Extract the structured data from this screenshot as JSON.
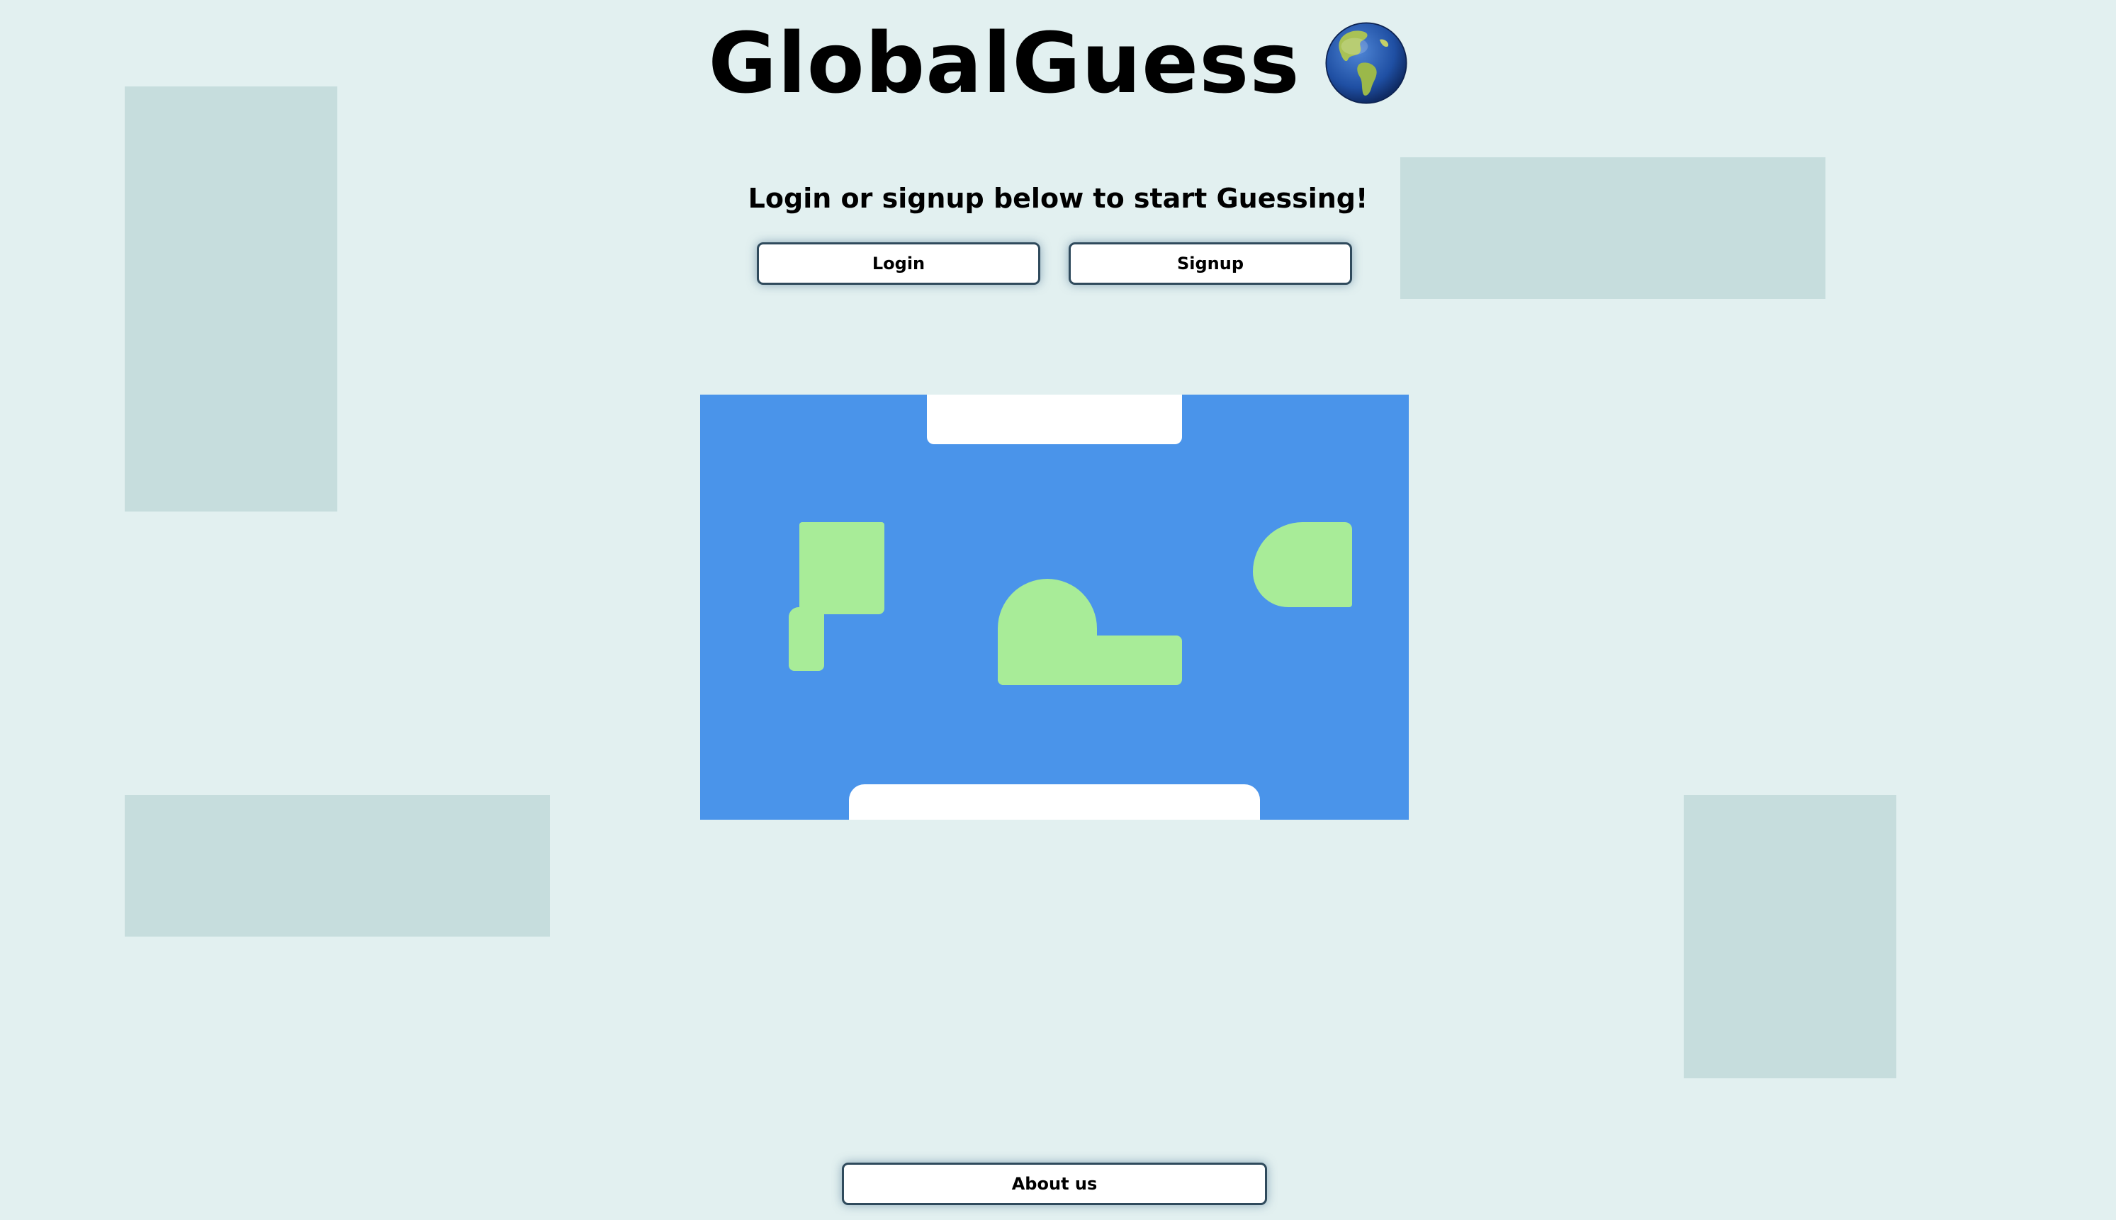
{
  "header": {
    "title": "GlobalGuess",
    "icon": "globe-americas-icon"
  },
  "prompt": {
    "text": "Login or signup below to start Guessing!"
  },
  "auth": {
    "login_label": "Login",
    "signup_label": "Signup"
  },
  "footer": {
    "about_label": "About us"
  },
  "colors": {
    "background": "#e2f0f0",
    "decor_block": "#c6dddd",
    "ocean": "#4a94ea",
    "land": "#a8ec98",
    "cloud": "#ffffff",
    "button_border": "#2f4a5c"
  }
}
